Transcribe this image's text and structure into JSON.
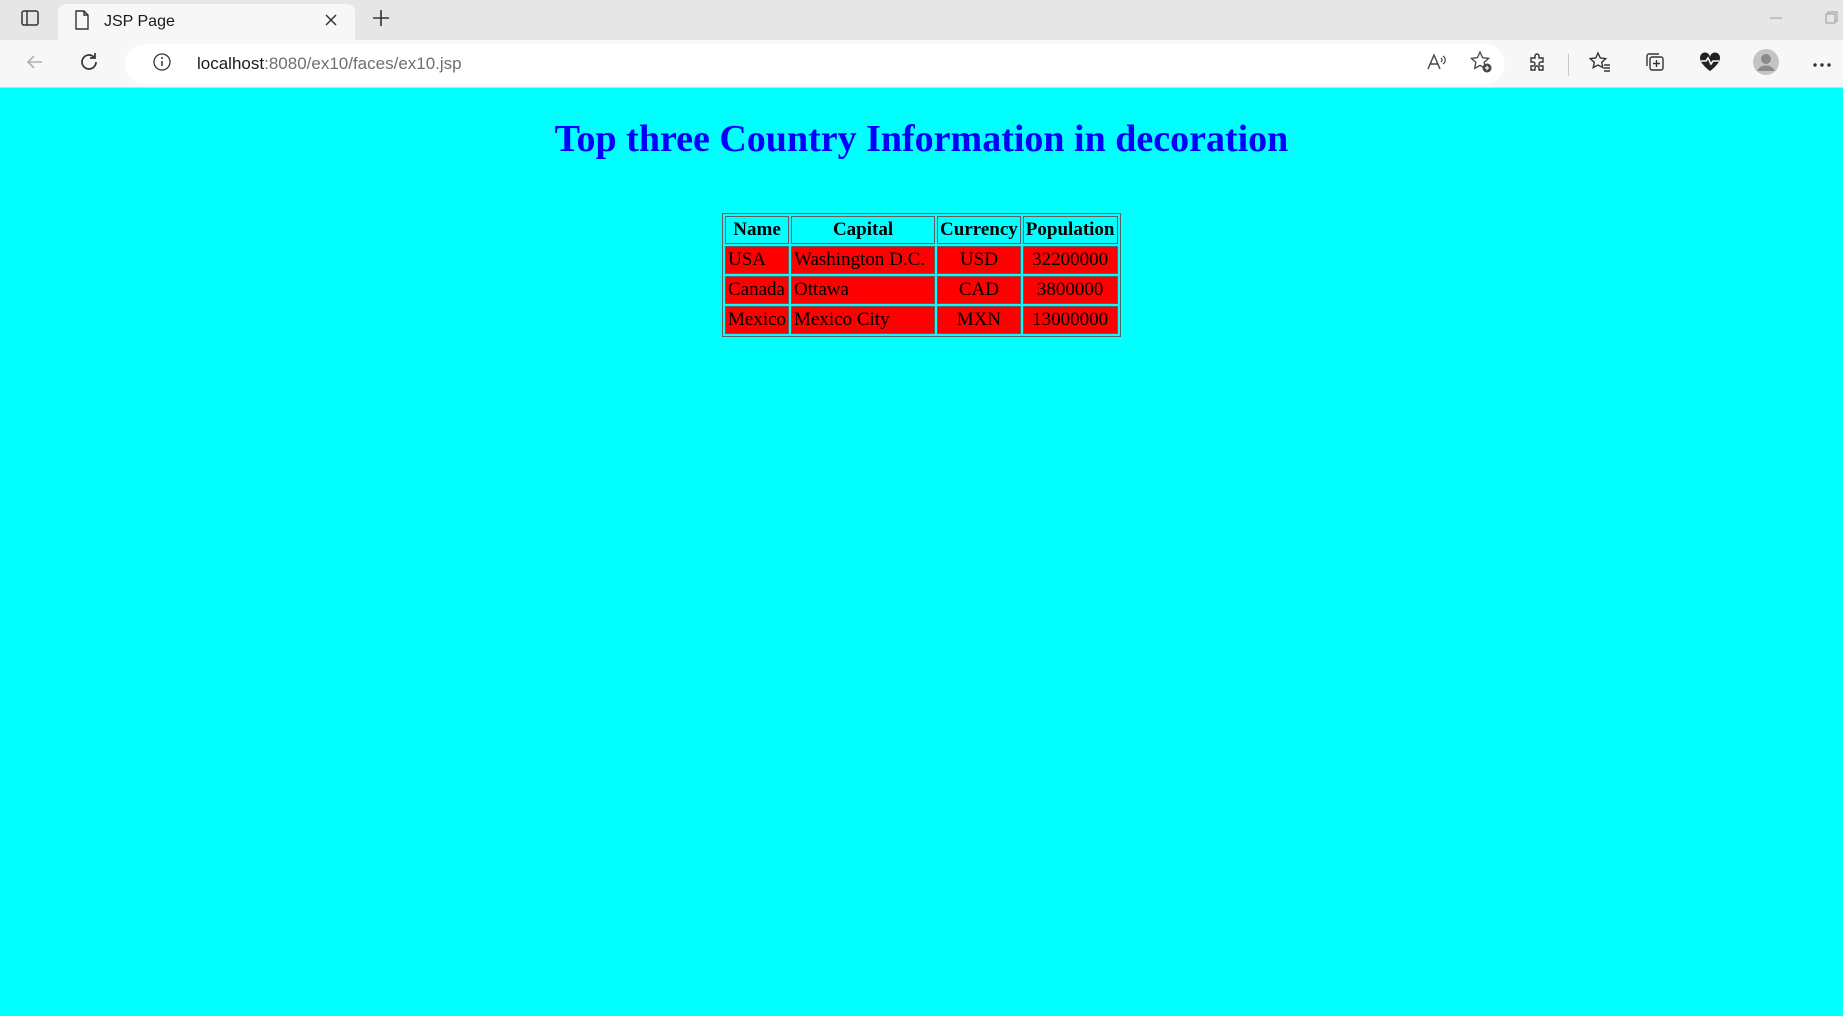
{
  "browser": {
    "tab_title": "JSP Page",
    "url_host": "localhost",
    "url_path": ":8080/ex10/faces/ex10.jsp"
  },
  "page": {
    "title": "Top three Country Information in decoration",
    "table": {
      "headers": [
        "Name",
        "Capital",
        "Currency",
        "Population"
      ],
      "rows": [
        [
          "USA",
          "Washington D.C.",
          "USD",
          "32200000"
        ],
        [
          "Canada",
          "Ottawa",
          "CAD",
          "3800000"
        ],
        [
          "Mexico",
          "Mexico City",
          "MXN",
          "13000000"
        ]
      ]
    }
  },
  "colors": {
    "page_background": "#00ffff",
    "title": "#0000ff",
    "data_cell_background": "#ff0000",
    "header_cell_background": "#00ffff"
  },
  "icons": {
    "tab_actions": "tab-actions-icon",
    "page": "page-icon",
    "close": "close-icon",
    "new_tab": "plus-icon",
    "back": "back-arrow-icon",
    "refresh": "refresh-icon",
    "site_info": "info-icon",
    "read_aloud": "read-aloud-icon",
    "add_favorite": "add-favorite-icon",
    "extensions": "puzzle-icon",
    "favorites": "favorites-icon",
    "collections": "collections-icon",
    "performance": "heart-pulse-icon",
    "profile": "avatar-icon",
    "more": "more-icon"
  }
}
